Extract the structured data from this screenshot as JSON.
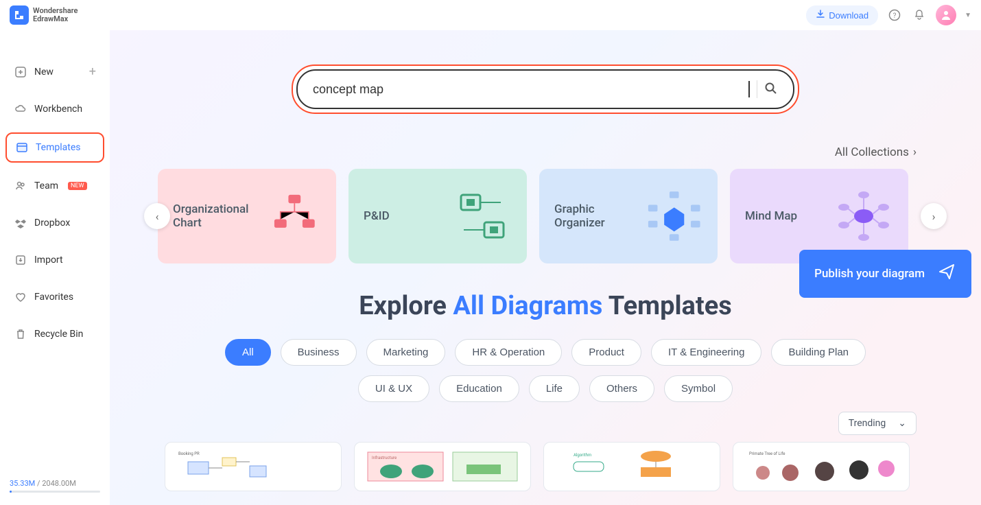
{
  "topbar": {
    "brand_line1": "Wondershare",
    "brand_line2": "EdrawMax",
    "download_label": "Download"
  },
  "sidebar": {
    "items": [
      {
        "label": "New",
        "icon": "plus-square-icon",
        "has_plus": true
      },
      {
        "label": "Workbench",
        "icon": "cloud-icon"
      },
      {
        "label": "Templates",
        "icon": "templates-icon",
        "active": true
      },
      {
        "label": "Team",
        "icon": "team-icon",
        "badge": "NEW"
      },
      {
        "label": "Dropbox",
        "icon": "dropbox-icon"
      },
      {
        "label": "Import",
        "icon": "import-icon"
      },
      {
        "label": "Favorites",
        "icon": "heart-icon"
      },
      {
        "label": "Recycle Bin",
        "icon": "trash-icon"
      }
    ],
    "storage_used": "35.33M",
    "storage_sep": " / ",
    "storage_total": "2048.00M"
  },
  "search": {
    "value": "concept map"
  },
  "all_collections_label": "All Collections",
  "category_cards": [
    {
      "label": "Organizational Chart"
    },
    {
      "label": "P&ID"
    },
    {
      "label": "Graphic Organizer"
    },
    {
      "label": "Mind Map"
    }
  ],
  "explore": {
    "prefix": "Explore ",
    "highlight": "All Diagrams",
    "suffix": " Templates"
  },
  "tags_row1": [
    "All",
    "Business",
    "Marketing",
    "HR & Operation",
    "Product",
    "IT & Engineering",
    "Building Plan"
  ],
  "tags_row2": [
    "UI & UX",
    "Education",
    "Life",
    "Others",
    "Symbol"
  ],
  "sort": {
    "selected": "Trending"
  },
  "publish_cta": "Publish your diagram",
  "template_previews": [
    {
      "caption": "Booking PR"
    },
    {
      "caption": "Infrastructure"
    },
    {
      "caption": "Algorithm"
    },
    {
      "caption": "Primate Tree of Life"
    }
  ]
}
